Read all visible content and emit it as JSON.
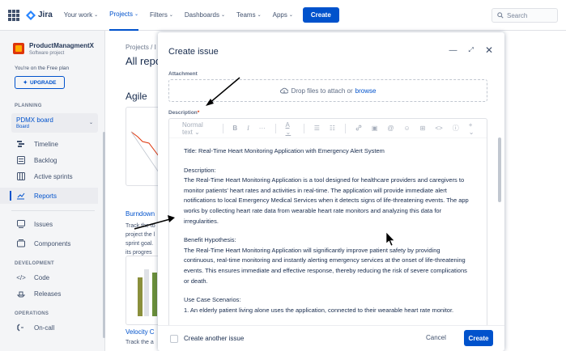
{
  "topnav": {
    "app_name": "Jira",
    "items": [
      {
        "label": "Your work"
      },
      {
        "label": "Projects"
      },
      {
        "label": "Filters"
      },
      {
        "label": "Dashboards"
      },
      {
        "label": "Teams"
      },
      {
        "label": "Apps"
      }
    ],
    "create_label": "Create",
    "search_placeholder": "Search"
  },
  "sidebar": {
    "project_name": "ProductManagmentX",
    "project_type": "Software project",
    "plan_text": "You're on the Free plan",
    "upgrade_label": "UPGRADE",
    "planning_label": "PLANNING",
    "board_name": "PDMX board",
    "board_type": "Board",
    "planning_items": [
      {
        "label": "Timeline"
      },
      {
        "label": "Backlog"
      },
      {
        "label": "Active sprints"
      },
      {
        "label": "Reports"
      }
    ],
    "other_items": [
      {
        "label": "Issues"
      },
      {
        "label": "Components"
      }
    ],
    "development_label": "DEVELOPMENT",
    "development_items": [
      {
        "label": "Code"
      },
      {
        "label": "Releases"
      }
    ],
    "operations_label": "OPERATIONS",
    "operations_items": [
      {
        "label": "On-call"
      }
    ]
  },
  "main": {
    "breadcrumb": "Projects / I",
    "page_title": "All repo",
    "section_title": "Agile",
    "burndown_title": "Burndown",
    "burndown_text": [
      "Track the to",
      "project the l",
      "sprint goal.",
      "its progres"
    ],
    "velocity_title": "Velocity C",
    "velocity_text": "Track the a"
  },
  "modal": {
    "title": "Create issue",
    "attachment_label": "Attachment",
    "drop_text": "Drop files to attach or",
    "browse_label": "browse",
    "description_label": "Description",
    "required_mark": "*",
    "toolbar": {
      "text_style": "Normal text",
      "bold": "B",
      "italic": "I",
      "more": "···",
      "color": "A",
      "bullet": "☰",
      "numbered": "☷",
      "link": "🔗",
      "image": "▣",
      "mention": "@",
      "emoji": "☺",
      "table": "⊞",
      "code": "<>",
      "info": "ⓘ",
      "insert": "+"
    },
    "description_title": "Title: Real-Time Heart Monitoring Application with Emergency Alert System",
    "description_heading": "Description:",
    "description_body": "The Real-Time Heart Monitoring Application is a tool designed for healthcare providers and caregivers to monitor patients' heart rates and activities in real-time. The application will provide immediate alert notifications to local Emergency Medical Services when it detects signs of life-threatening events. The app works by collecting heart rate data from wearable heart rate monitors and analyzing this data for irregularities.",
    "benefit_heading": "Benefit Hypothesis:",
    "benefit_body": "The Real-Time Heart Monitoring Application will significantly improve patient safety by providing continuous, real-time monitoring and instantly alerting emergency services at the onset of life-threatening events. This ensures immediate and effective response, thereby reducing the risk of severe complications or death.",
    "use_case_heading": "Use Case Scenarios:",
    "use_case_1": "1. An elderly patient living alone uses the application, connected to their wearable heart rate monitor.",
    "create_another_label": "Create another issue",
    "cancel_label": "Cancel",
    "create_label": "Create"
  },
  "colors": {
    "brand": "#0052cc",
    "nav_text": "#42526e",
    "sidebar_bg": "#f4f5f7"
  }
}
